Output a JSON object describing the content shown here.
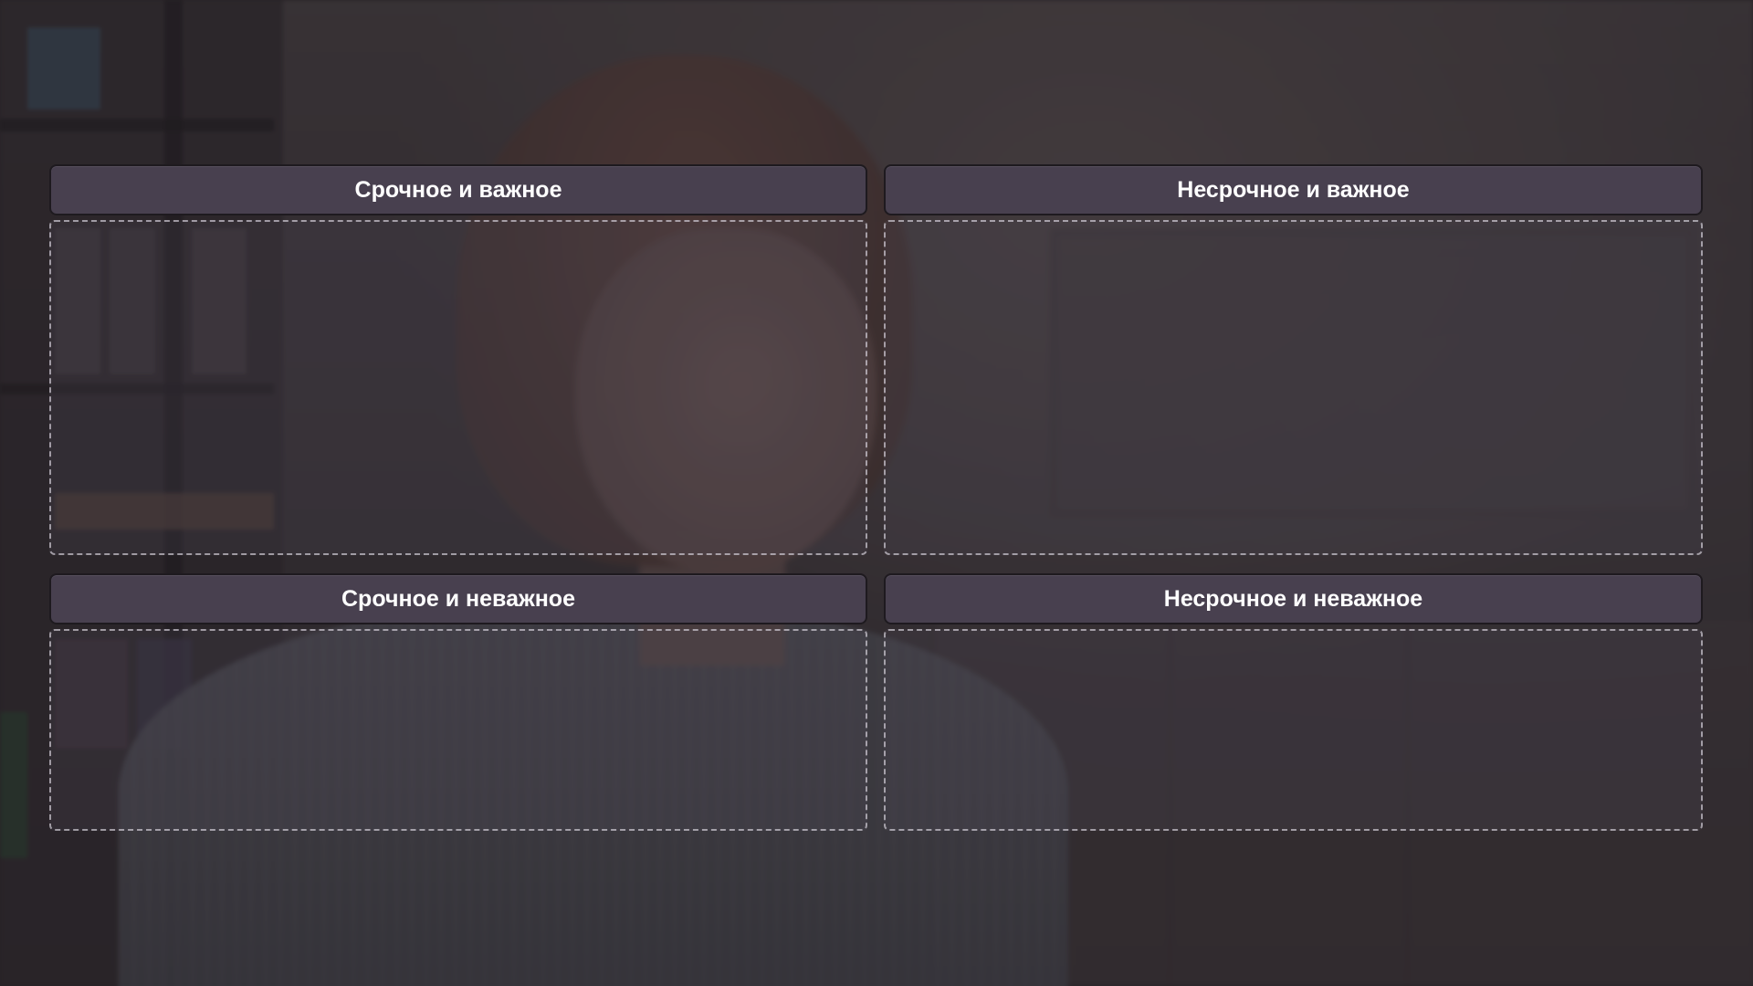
{
  "background": {
    "description_icon": "office-photo",
    "overlay_color": "#19161a"
  },
  "matrix": {
    "quadrants": [
      {
        "id": "urgent-important",
        "label": "Срочное и важное"
      },
      {
        "id": "not-urgent-important",
        "label": "Несрочное и важное"
      },
      {
        "id": "urgent-not-important",
        "label": "Срочное и неважное"
      },
      {
        "id": "not-urgent-not-important",
        "label": "Несрочное и неважное"
      }
    ]
  },
  "colors": {
    "header_bg": "#48404f",
    "header_text": "#ffffff",
    "zone_border": "#dcd7e1"
  }
}
